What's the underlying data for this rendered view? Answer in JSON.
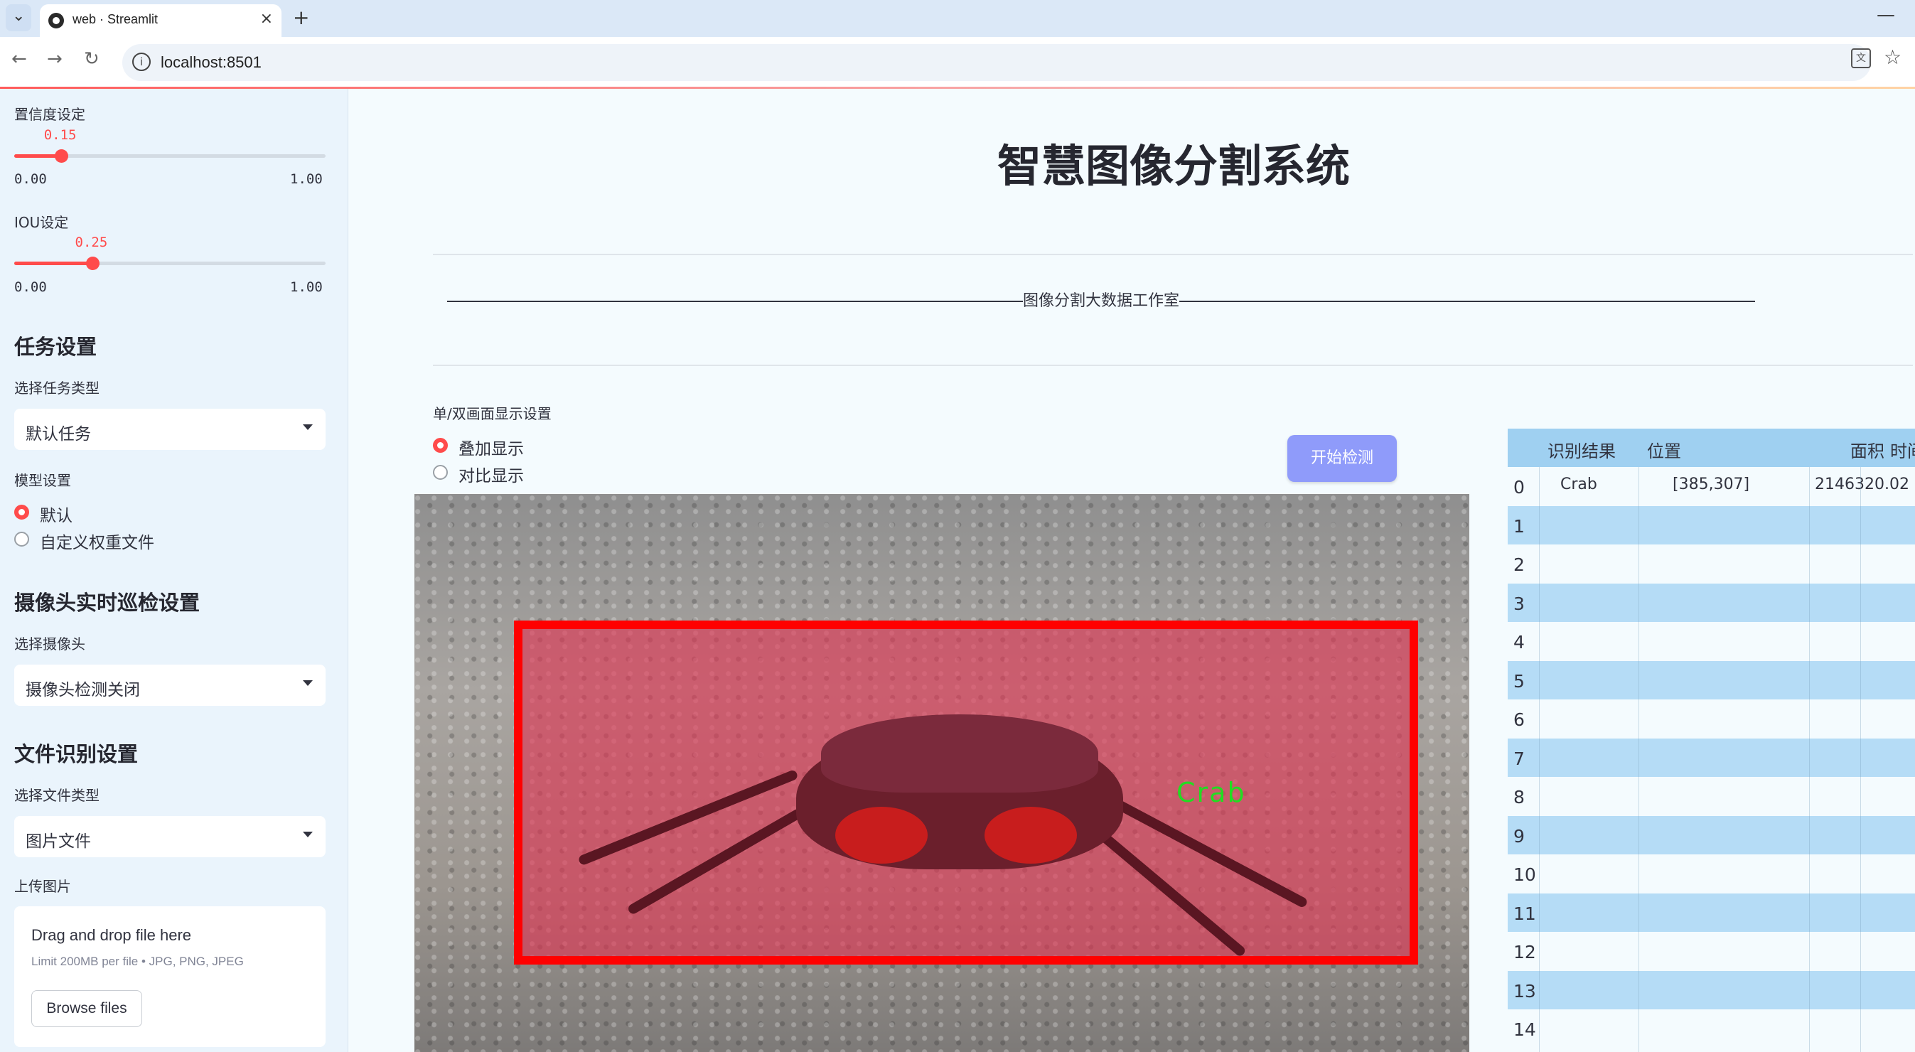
{
  "browser": {
    "tab_title": "web · Streamlit",
    "url": "localhost:8501"
  },
  "sidebar": {
    "confidence": {
      "label": "置信度设定",
      "value": "0.15",
      "value_num": 0.15,
      "min": "0.00",
      "max": "1.00"
    },
    "iou": {
      "label": "IOU设定",
      "value": "0.25",
      "value_num": 0.25,
      "min": "0.00",
      "max": "1.00"
    },
    "task_settings": {
      "heading": "任务设置",
      "select_label": "选择任务类型",
      "selected": "默认任务"
    },
    "model_settings": {
      "label": "模型设置",
      "options": [
        "默认",
        "自定义权重文件"
      ],
      "selected_index": 0
    },
    "camera_settings": {
      "heading": "摄像头实时巡检设置",
      "select_label": "选择摄像头",
      "selected": "摄像头检测关闭"
    },
    "file_settings": {
      "heading": "文件识别设置",
      "select_label": "选择文件类型",
      "selected": "图片文件",
      "upload_label": "上传图片",
      "drop_text": "Drag and drop file here",
      "limit_text": "Limit 200MB per file • JPG, PNG, JPEG",
      "browse_label": "Browse files"
    }
  },
  "main": {
    "title": "智慧图像分割系统",
    "studio": "图像分割大数据工作室",
    "display_label": "单/双画面显示设置",
    "display_options": [
      "叠加显示",
      "对比显示"
    ],
    "display_selected_index": 0,
    "start_button": "开始检测",
    "detection_label": "Crab"
  },
  "results_table": {
    "columns": [
      "识别结果",
      "位置",
      "面积",
      "时间"
    ],
    "rows": [
      {
        "index": "0",
        "result": "Crab",
        "position": "[385,307]",
        "area": "2146320.02",
        "time": ""
      },
      {
        "index": "1"
      },
      {
        "index": "2"
      },
      {
        "index": "3"
      },
      {
        "index": "4"
      },
      {
        "index": "5"
      },
      {
        "index": "6"
      },
      {
        "index": "7"
      },
      {
        "index": "8"
      },
      {
        "index": "9"
      },
      {
        "index": "10"
      },
      {
        "index": "11"
      },
      {
        "index": "12"
      },
      {
        "index": "13"
      },
      {
        "index": "14"
      }
    ]
  },
  "colors": {
    "accent": "#ff4b4b",
    "button": "#8f9bfa",
    "table_header": "#9fd0f1",
    "table_alt_row": "#b5dcf6",
    "detection_box": "#ff0000",
    "detection_label": "#22dd22"
  },
  "icons": [
    "tab-dropdown-icon",
    "streamlit-favicon",
    "close-icon",
    "plus-icon",
    "minimize-icon",
    "back-icon",
    "forward-icon",
    "reload-icon",
    "info-icon",
    "translate-icon",
    "star-icon",
    "chevron-down-icon"
  ]
}
